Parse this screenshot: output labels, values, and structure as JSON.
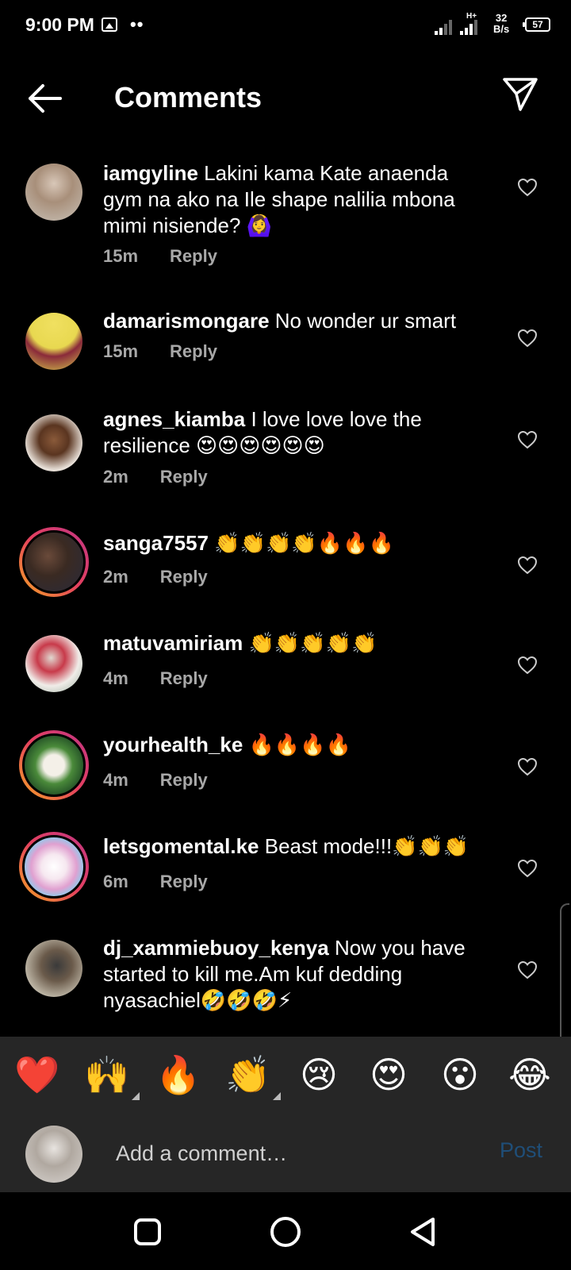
{
  "status_bar": {
    "time": "9:00 PM",
    "dots": "••",
    "network_type": "H+",
    "speed_value": "32",
    "speed_unit": "B/s",
    "battery": "57"
  },
  "header": {
    "title": "Comments",
    "back_icon": "arrow-left-icon",
    "share_icon": "paper-plane-icon"
  },
  "comments": [
    {
      "username": "iamgyline",
      "text": "Lakini kama Kate anaenda gym na ako na Ile shape nalilia mbona mimi nisiende? 🙆‍♀️",
      "time": "15m",
      "reply_label": "Reply"
    },
    {
      "username": "damarismongare",
      "text": "No wonder ur smart",
      "time": "15m",
      "reply_label": "Reply"
    },
    {
      "username": "agnes_kiamba",
      "text": "I love love love the resilience 😍😍😍😍😍😍",
      "time": "2m",
      "reply_label": "Reply"
    },
    {
      "username": "sanga7557",
      "text": "👏👏👏👏🔥🔥🔥",
      "time": "2m",
      "reply_label": "Reply"
    },
    {
      "username": "matuvamiriam",
      "text": "👏👏👏👏👏",
      "time": "4m",
      "reply_label": "Reply"
    },
    {
      "username": "yourhealth_ke",
      "text": "🔥🔥🔥🔥",
      "time": "4m",
      "reply_label": "Reply"
    },
    {
      "username": "letsgomental.ke",
      "text": "Beast mode!!!👏👏👏",
      "time": "6m",
      "reply_label": "Reply"
    },
    {
      "username": "dj_xammiebuoy_kenya",
      "text": "Now you have started to kill me.Am kuf dedding nyasachiel🤣🤣🤣⚡",
      "time": "",
      "reply_label": ""
    }
  ],
  "quick_reactions": [
    "❤️",
    "🙌",
    "🔥",
    "👏",
    "😢",
    "😍",
    "😮",
    "😂"
  ],
  "composer": {
    "placeholder": "Add a comment…",
    "post_label": "Post"
  },
  "colors": {
    "background": "#000000",
    "panel": "#262626",
    "muted_text": "#a8a8a8",
    "post_disabled": "#1f4e78",
    "story_ring": "#e4405f"
  }
}
